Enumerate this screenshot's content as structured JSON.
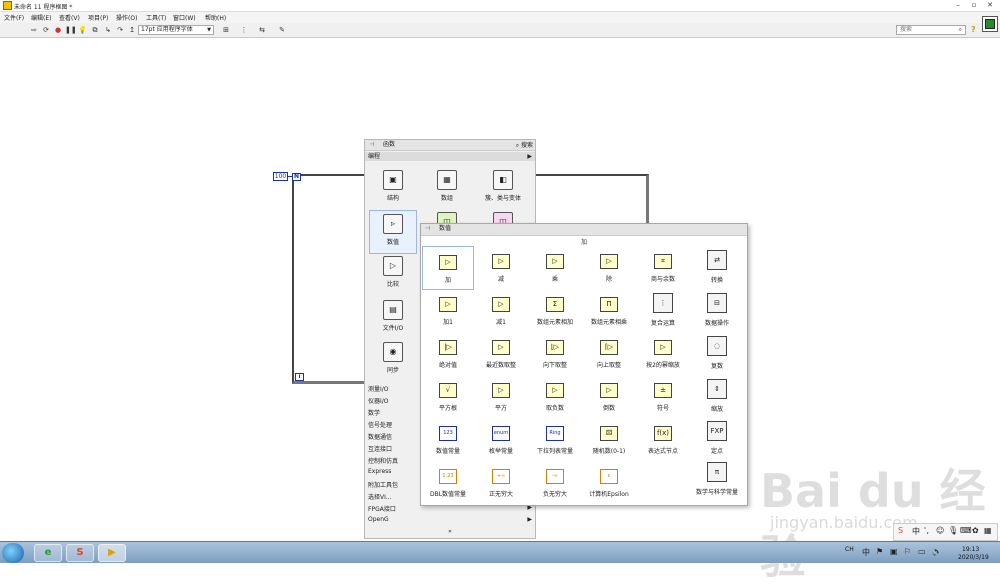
{
  "window": {
    "title": "未命名 11 程序框图 *"
  },
  "menu": [
    "文件(F)",
    "编辑(E)",
    "查看(V)",
    "项目(P)",
    "操作(O)",
    "工具(T)",
    "窗口(W)",
    "帮助(H)"
  ],
  "toolbar": {
    "font_select": "17pt 应用程序字体",
    "search_placeholder": "搜索"
  },
  "diagram": {
    "const_value": "100",
    "n_terminal": "N",
    "i_terminal": "i"
  },
  "functions_palette": {
    "title": "函数",
    "search_label": "搜索",
    "category": "编程",
    "items": [
      {
        "label": "结构",
        "icon": "structure-icon"
      },
      {
        "label": "数组",
        "icon": "array-icon"
      },
      {
        "label": "簇、类与变体",
        "icon": "cluster-icon"
      },
      {
        "label": "数值",
        "icon": "numeric-icon"
      },
      {
        "label": "比较",
        "icon": "comparison-icon"
      },
      {
        "label": "文件I/O",
        "icon": "file-io-icon"
      },
      {
        "label": "同步",
        "icon": "sync-icon"
      }
    ],
    "categories": [
      "测量I/O",
      "仪器I/O",
      "数学",
      "信号处理",
      "数据通信",
      "互连接口",
      "控制和仿真",
      "Express",
      "附加工具包",
      "选择VI...",
      "FPGA接口",
      "OpenG"
    ],
    "more": "»"
  },
  "numeric_palette": {
    "title": "数值",
    "hover_label": "加",
    "items": [
      [
        "加",
        "减",
        "乘",
        "除",
        "商与余数",
        "转换"
      ],
      [
        "加1",
        "减1",
        "数组元素相加",
        "数组元素相乘",
        "复合运算",
        "数据操作"
      ],
      [
        "绝对值",
        "最近数取整",
        "向下取整",
        "向上取整",
        "按2的幂缩放",
        "复数"
      ],
      [
        "平方根",
        "平方",
        "取负数",
        "倒数",
        "符号",
        "缩放"
      ],
      [
        "数值常量",
        "枚举常量",
        "下拉列表常量",
        "随机数(0-1)",
        "表达式节点",
        "定点"
      ],
      [
        "DBL数值常量",
        "正无穷大",
        "负无穷大",
        "计算机Epsilon",
        "",
        "数学与科学常量"
      ]
    ]
  },
  "taskbar": {
    "tray_lang": "CH",
    "time": "19:13",
    "date": "2020/3/19"
  },
  "watermark": {
    "text": "Bai du 经验",
    "url": "jingyan.baidu.com"
  }
}
